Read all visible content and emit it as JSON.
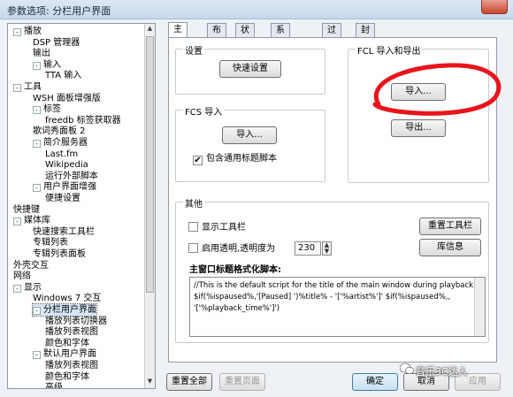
{
  "window": {
    "title": "参数选项: 分栏用户界面"
  },
  "tree": {
    "items": [
      {
        "label": "播放",
        "exp": "-"
      },
      {
        "label": "DSP 管理器"
      },
      {
        "label": "输出"
      },
      {
        "label": "输入",
        "exp": "-"
      },
      {
        "label": "TTA 输入"
      },
      {
        "label": "工具",
        "exp": "-"
      },
      {
        "label": "WSH 面板增强版"
      },
      {
        "label": "标签",
        "exp": "-"
      },
      {
        "label": "freedb 标签获取器"
      },
      {
        "label": "歌词秀面板 2"
      },
      {
        "label": "简介服务器",
        "exp": "-"
      },
      {
        "label": "Last.fm"
      },
      {
        "label": "Wikipedia"
      },
      {
        "label": "运行外部脚本"
      },
      {
        "label": "用户界面增强",
        "exp": "-"
      },
      {
        "label": "便捷设置"
      },
      {
        "label": "快捷键"
      },
      {
        "label": "媒体库",
        "exp": "-"
      },
      {
        "label": "快速搜索工具栏"
      },
      {
        "label": "专辑列表"
      },
      {
        "label": "专辑列表面板"
      },
      {
        "label": "外壳交互"
      },
      {
        "label": "网络"
      },
      {
        "label": "显示",
        "exp": "-"
      },
      {
        "label": "Windows 7 交互"
      },
      {
        "label": "分栏用户界面",
        "exp": "-"
      },
      {
        "label": "播放列表切换器"
      },
      {
        "label": "播放列表视图"
      },
      {
        "label": "颜色和字体"
      },
      {
        "label": "默认用户界面",
        "exp": "-"
      },
      {
        "label": "播放列表视图"
      },
      {
        "label": "颜色和字体"
      },
      {
        "label": "高级"
      }
    ]
  },
  "tabs": [
    "主窗口",
    "布局",
    "状态栏",
    "系统托盘区",
    "过滤器",
    "封面"
  ],
  "settings_group": {
    "label": "设置",
    "quick_btn": "快速设置"
  },
  "fcl_group": {
    "label": "FCL 导入和导出",
    "import_btn": "导入...",
    "export_btn": "导出..."
  },
  "fcs_group": {
    "label": "FCS 导入",
    "import_btn": "导入...",
    "check_label": "包含通用标题脚本",
    "checked": true
  },
  "other_group": {
    "label": "其他",
    "show_toolbar": "显示工具栏",
    "transparency": "启用透明,透明度为",
    "transparency_value": "230",
    "reset_toolbar": "重置工具栏",
    "lib_info": "库信息",
    "script_label": "主窗口标题格式化脚本:",
    "script_lines": [
      "//This is the default script for the title of the main window during playback.",
      "",
      "$if(%ispaused%,'[Paused] ')%title% - '['%artist%']' $if(%ispaused%,,",
      "'['%playback_time%']')"
    ]
  },
  "footer": {
    "reset_all": "重置全部",
    "reset_page": "重置页面",
    "ok": "确定",
    "cancel": "取消",
    "apply": "应用"
  },
  "watermark": "音乐3C达人",
  "colors": {
    "annotation": "#e8141c",
    "tab_active": "#ffffff",
    "titlebar": "#c8d8ec"
  }
}
